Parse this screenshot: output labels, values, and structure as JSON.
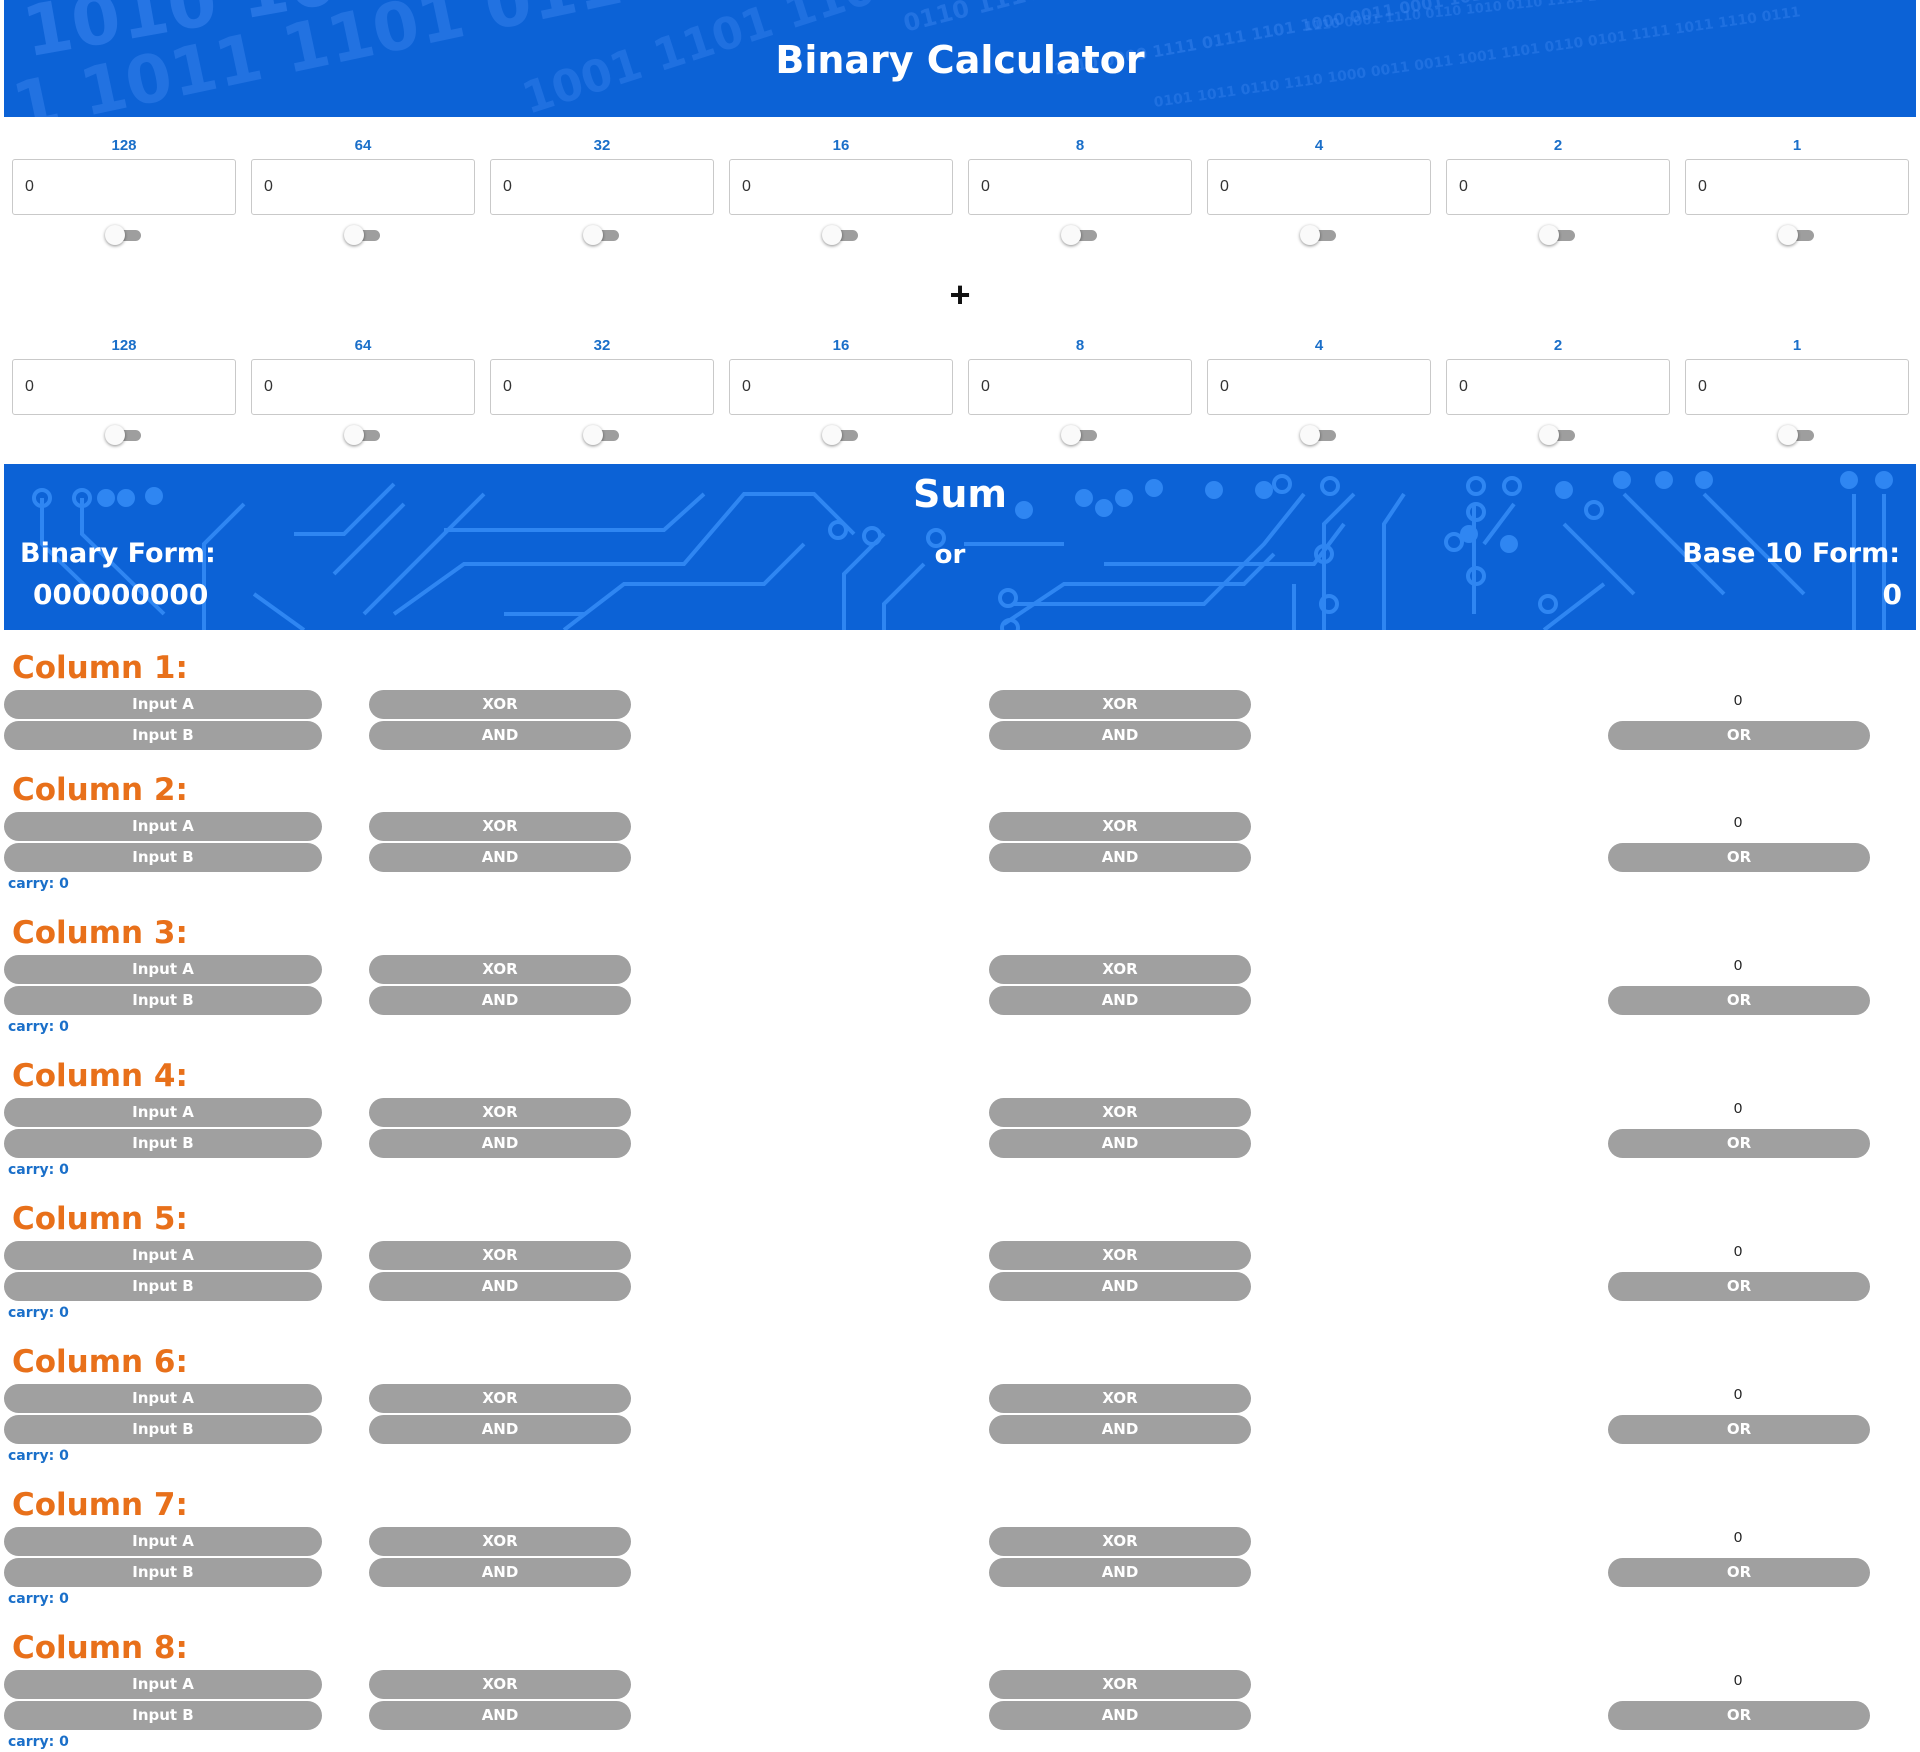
{
  "header": {
    "title": "Binary Calculator"
  },
  "input_a": {
    "bits": [
      {
        "label": "128",
        "value": "0"
      },
      {
        "label": "64",
        "value": "0"
      },
      {
        "label": "32",
        "value": "0"
      },
      {
        "label": "16",
        "value": "0"
      },
      {
        "label": "8",
        "value": "0"
      },
      {
        "label": "4",
        "value": "0"
      },
      {
        "label": "2",
        "value": "0"
      },
      {
        "label": "1",
        "value": "0"
      }
    ]
  },
  "operator": "+",
  "input_b": {
    "bits": [
      {
        "label": "128",
        "value": "0"
      },
      {
        "label": "64",
        "value": "0"
      },
      {
        "label": "32",
        "value": "0"
      },
      {
        "label": "16",
        "value": "0"
      },
      {
        "label": "8",
        "value": "0"
      },
      {
        "label": "4",
        "value": "0"
      },
      {
        "label": "2",
        "value": "0"
      },
      {
        "label": "1",
        "value": "0"
      }
    ]
  },
  "sum": {
    "title": "Sum",
    "or_label": "or",
    "binary_label": "Binary Form:",
    "binary_value": "000000000",
    "base10_label": "Base 10 Form:",
    "base10_value": "0"
  },
  "columns": [
    {
      "title": "Column 1:",
      "input_a": "Input A",
      "input_b": "Input B",
      "xor1": "XOR",
      "and1": "AND",
      "xor2": "XOR",
      "and2": "AND",
      "result": "0",
      "or": "OR"
    },
    {
      "title": "Column 2:",
      "input_a": "Input A",
      "input_b": "Input B",
      "xor1": "XOR",
      "and1": "AND",
      "xor2": "XOR",
      "and2": "AND",
      "result": "0",
      "or": "OR",
      "carry": "carry: 0"
    },
    {
      "title": "Column 3:",
      "input_a": "Input A",
      "input_b": "Input B",
      "xor1": "XOR",
      "and1": "AND",
      "xor2": "XOR",
      "and2": "AND",
      "result": "0",
      "or": "OR",
      "carry": "carry: 0"
    },
    {
      "title": "Column 4:",
      "input_a": "Input A",
      "input_b": "Input B",
      "xor1": "XOR",
      "and1": "AND",
      "xor2": "XOR",
      "and2": "AND",
      "result": "0",
      "or": "OR",
      "carry": "carry: 0"
    },
    {
      "title": "Column 5:",
      "input_a": "Input A",
      "input_b": "Input B",
      "xor1": "XOR",
      "and1": "AND",
      "xor2": "XOR",
      "and2": "AND",
      "result": "0",
      "or": "OR",
      "carry": "carry: 0"
    },
    {
      "title": "Column 6:",
      "input_a": "Input A",
      "input_b": "Input B",
      "xor1": "XOR",
      "and1": "AND",
      "xor2": "XOR",
      "and2": "AND",
      "result": "0",
      "or": "OR",
      "carry": "carry: 0"
    },
    {
      "title": "Column 7:",
      "input_a": "Input A",
      "input_b": "Input B",
      "xor1": "XOR",
      "and1": "AND",
      "xor2": "XOR",
      "and2": "AND",
      "result": "0",
      "or": "OR",
      "carry": "carry: 0"
    },
    {
      "title": "Column 8:",
      "input_a": "Input A",
      "input_b": "Input B",
      "xor1": "XOR",
      "and1": "AND",
      "xor2": "XOR",
      "and2": "AND",
      "result": "0",
      "or": "OR",
      "carry": "carry: 0"
    }
  ],
  "colors": {
    "brand_blue": "#0c62d6",
    "pill_gray": "#a0a0a0",
    "column_title_orange": "#e8701a",
    "label_blue": "#1a6fc9"
  }
}
